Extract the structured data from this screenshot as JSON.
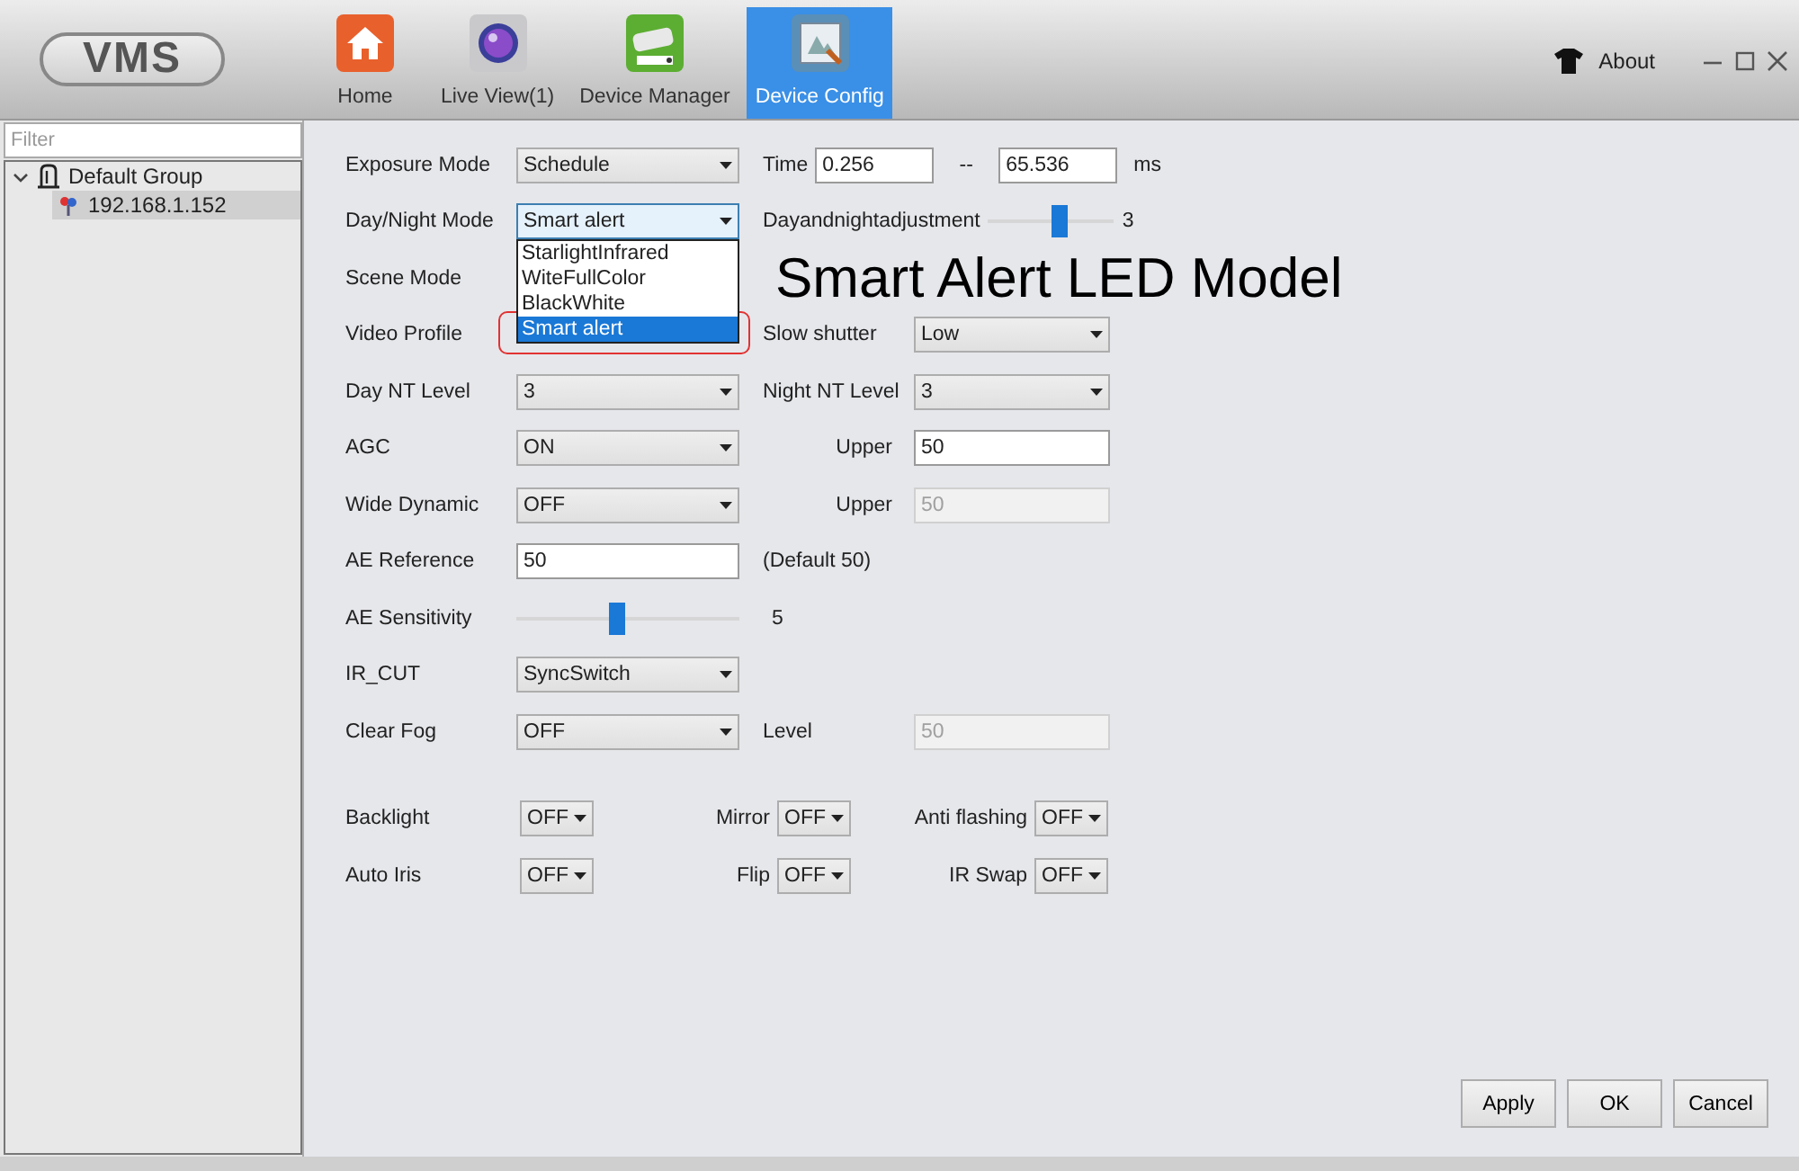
{
  "logo": "VMS",
  "nav": [
    {
      "label": "Home",
      "kind": "home",
      "selected": false
    },
    {
      "label": "Live View(1)",
      "kind": "live",
      "selected": false
    },
    {
      "label": "Device Manager",
      "kind": "manager",
      "selected": false
    },
    {
      "label": "Device Config",
      "kind": "config",
      "selected": true
    }
  ],
  "about": "About",
  "tree": {
    "filter_placeholder": "Filter",
    "groups": [
      {
        "label": "Default Group",
        "expanded": true,
        "children": [
          {
            "label": "192.168.1.152",
            "selected": true
          }
        ]
      }
    ]
  },
  "form": {
    "rows": [
      {
        "label": "Exposure Mode",
        "control": {
          "kind": "select",
          "value": "Schedule"
        },
        "extra": [
          {
            "kind": "inline_label",
            "text": "Time"
          },
          {
            "kind": "input_small",
            "value": "0.256"
          },
          {
            "kind": "sep",
            "text": "--"
          },
          {
            "kind": "input_small",
            "value": "65.536"
          },
          {
            "kind": "unit",
            "text": "ms"
          }
        ]
      },
      {
        "label": "Day/Night Mode",
        "control": {
          "kind": "select",
          "value": "Smart alert",
          "open": true,
          "options": [
            {
              "label": "StarlightInfrared",
              "selected": false
            },
            {
              "label": "WiteFullColor",
              "selected": false
            },
            {
              "label": "BlackWhite",
              "selected": false
            },
            {
              "label": "Smart alert",
              "selected": true
            }
          ]
        },
        "extra": [
          {
            "kind": "inline_label",
            "text": "Dayandnightadjustment"
          },
          {
            "kind": "slider",
            "level": 0.58
          },
          {
            "kind": "value",
            "text": "3"
          }
        ]
      },
      {
        "label": "Scene Mode",
        "extra": []
      },
      {
        "label": "Video Profile",
        "extra": [
          {
            "kind": "label",
            "text": "Slow shutter"
          },
          {
            "kind": "select",
            "value": "Low"
          }
        ]
      },
      {
        "label": "Day NT Level",
        "control": {
          "kind": "select",
          "value": "3"
        },
        "extra": [
          {
            "kind": "label",
            "text": "Night NT Level"
          },
          {
            "kind": "select",
            "value": "3"
          }
        ]
      },
      {
        "label": "AGC",
        "control": {
          "kind": "select",
          "value": "ON"
        },
        "extra": [
          {
            "kind": "rlabel",
            "text": "Upper"
          },
          {
            "kind": "input",
            "value": "50",
            "disabled": false
          }
        ]
      },
      {
        "label": "Wide Dynamic",
        "control": {
          "kind": "select",
          "value": "OFF"
        },
        "extra": [
          {
            "kind": "rlabel",
            "text": "Upper"
          },
          {
            "kind": "input",
            "value": "50",
            "disabled": true
          }
        ]
      },
      {
        "label": "AE Reference",
        "control": {
          "kind": "input",
          "value": "50",
          "disabled": false
        },
        "extra": [
          {
            "kind": "note",
            "text": "(Default 50)"
          }
        ]
      },
      {
        "label": "AE Sensitivity",
        "control": {
          "kind": "slider",
          "level": 0.45
        },
        "extra": [
          {
            "kind": "value",
            "text": "5"
          }
        ]
      },
      {
        "label": "IR_CUT",
        "control": {
          "kind": "select",
          "value": "SyncSwitch"
        },
        "extra": []
      },
      {
        "label": "Clear Fog",
        "control": {
          "kind": "select",
          "value": "OFF"
        },
        "extra": [
          {
            "kind": "label",
            "text": "Level"
          },
          {
            "kind": "input",
            "value": "50",
            "disabled": true
          }
        ]
      }
    ],
    "switches": [
      [
        {
          "label": "Backlight",
          "value": "OFF"
        },
        {
          "label": "Mirror",
          "value": "OFF"
        },
        {
          "label": "Anti flashing",
          "value": "OFF"
        }
      ],
      [
        {
          "label": "Auto Iris",
          "value": "OFF"
        },
        {
          "label": "Flip",
          "value": "OFF"
        },
        {
          "label": "IR Swap",
          "value": "OFF"
        }
      ]
    ]
  },
  "annotation": "Smart Alert LED Model",
  "buttons": [
    "Apply",
    "OK",
    "Cancel"
  ]
}
